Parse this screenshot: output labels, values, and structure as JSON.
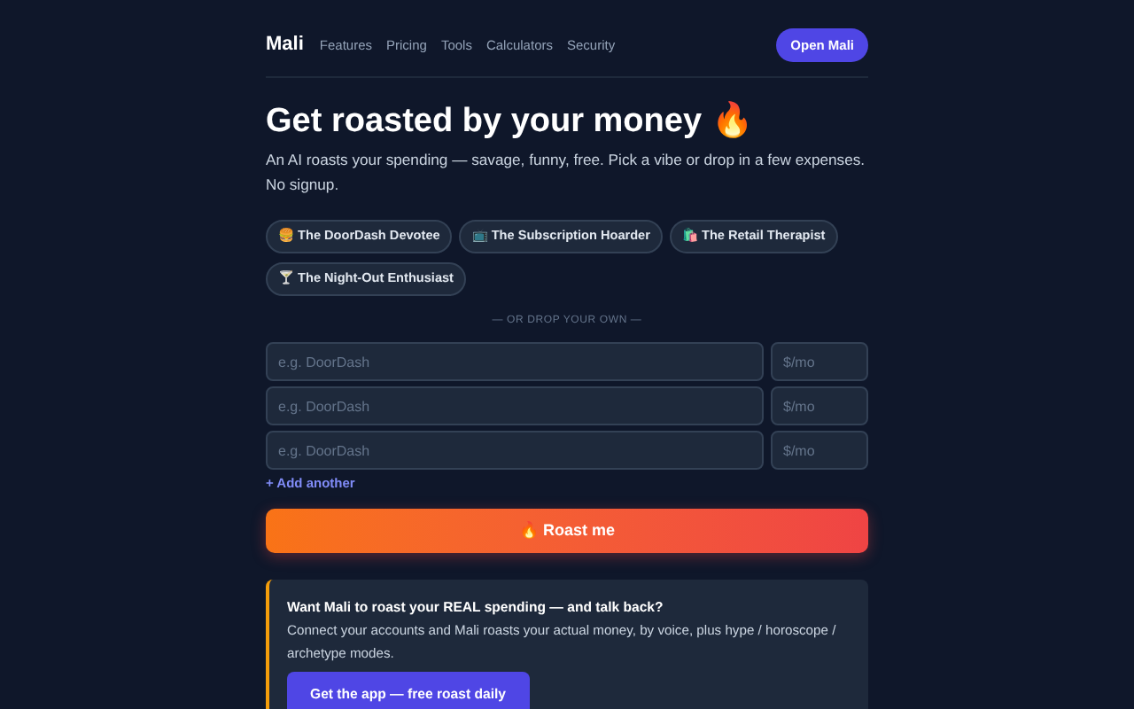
{
  "nav": {
    "brand": "Mali",
    "links": [
      "Features",
      "Pricing",
      "Tools",
      "Calculators",
      "Security"
    ],
    "cta": "Open Mali"
  },
  "hero": {
    "title": "Get roasted by your money 🔥",
    "subtitle": "An AI roasts your spending — savage, funny, free. Pick a vibe or drop in a few expenses. No signup."
  },
  "vibes": [
    "🍔 The DoorDash Devotee",
    "📺 The Subscription Hoarder",
    "🛍️ The Retail Therapist",
    "🍸 The Night-Out Enthusiast"
  ],
  "divider": "— OR DROP YOUR OWN —",
  "expenses": [
    {
      "name_placeholder": "e.g. DoorDash",
      "amount_placeholder": "$/mo"
    },
    {
      "name_placeholder": "e.g. DoorDash",
      "amount_placeholder": "$/mo"
    },
    {
      "name_placeholder": "e.g. DoorDash",
      "amount_placeholder": "$/mo"
    }
  ],
  "add_link": "+ Add another",
  "roast_button": "🔥 Roast me",
  "promo": {
    "title": "Want Mali to roast your REAL spending — and talk back?",
    "body": "Connect your accounts and Mali roasts your actual money, by voice, plus hype / horoscope / archetype modes.",
    "button": "Get the app — free roast daily"
  }
}
